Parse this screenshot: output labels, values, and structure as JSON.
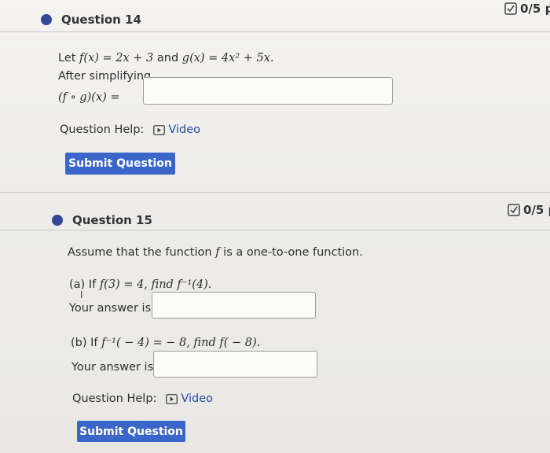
{
  "q14": {
    "title": "Question 14",
    "score": "0/5 p",
    "line1_prefix": "Let ",
    "f_def": "f(x) = 2x + 3",
    "and": " and ",
    "g_def": "g(x) = 4x² + 5x.",
    "line2": "After simplifying,",
    "comp": "(f ∘ g)(x) =",
    "answer": "",
    "help_label": "Question Help:",
    "video_label": "Video",
    "submit": "Submit Question"
  },
  "q15": {
    "title": "Question 15",
    "score": "0/5 p",
    "intro_prefix": "Assume that the function ",
    "intro_f": "f",
    "intro_suffix": " is a one-to-one function.",
    "a_prefix": "(a) If ",
    "a_math": "f(3) = 4, find f⁻¹(4).",
    "a_answer_label": "Your answer is",
    "a_answer": "",
    "b_prefix": "(b) If ",
    "b_math": "f⁻¹( − 4) =  − 8, find f( − 8).",
    "b_answer_label": "Your answer is",
    "b_answer": "",
    "help_label": "Question Help:",
    "video_label": "Video",
    "submit": "Submit Question"
  },
  "colors": {
    "accent": "#3a66c9",
    "bullet": "#34479a",
    "link": "#2a49a8"
  },
  "icons": {
    "score": "checkbox-icon",
    "video": "play-video-icon",
    "bullet": "circle-bullet-icon"
  }
}
